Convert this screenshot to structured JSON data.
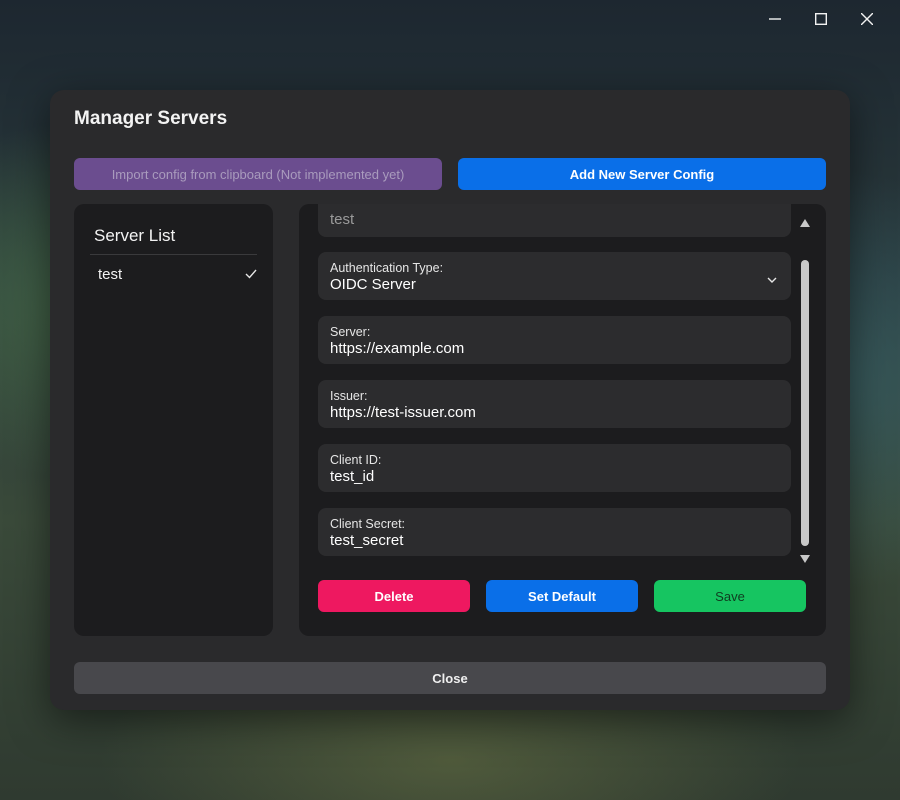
{
  "window": {
    "controls": [
      "minimize-icon",
      "maximize-icon",
      "close-icon"
    ]
  },
  "dialog": {
    "title": "Manager Servers",
    "import_label": "Import config from clipboard (Not implemented yet)",
    "add_label": "Add New Server Config",
    "close_label": "Close"
  },
  "server_list": {
    "title": "Server List",
    "items": [
      {
        "name": "test",
        "selected": true
      }
    ]
  },
  "form": {
    "name_value": "test",
    "auth_type": {
      "label": "Authentication Type:",
      "value": "OIDC Server"
    },
    "server": {
      "label": "Server:",
      "value": "https://example.com"
    },
    "issuer": {
      "label": "Issuer:",
      "value": "https://test-issuer.com"
    },
    "client_id": {
      "label": "Client ID:",
      "value": "test_id"
    },
    "client_secret": {
      "label": "Client Secret:",
      "value": "test_secret"
    },
    "delete_label": "Delete",
    "set_default_label": "Set Default",
    "save_label": "Save"
  },
  "colors": {
    "import": "#6b4d8f",
    "primary": "#0a6fe8",
    "danger": "#ee1860",
    "success": "#16c561",
    "neutral": "#48484c"
  }
}
